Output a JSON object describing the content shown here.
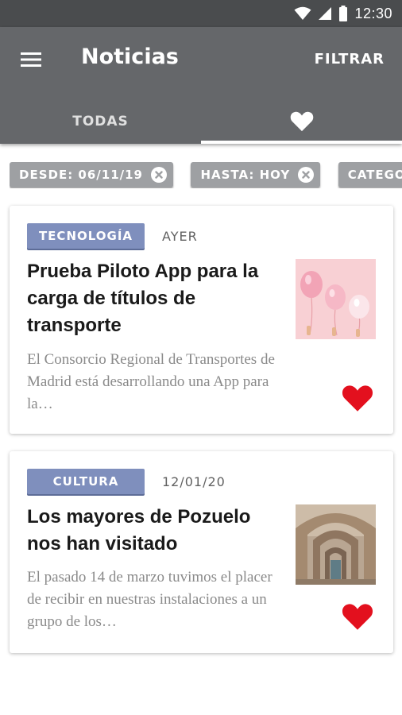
{
  "status": {
    "time": "12:30"
  },
  "app_bar": {
    "title": "Noticias",
    "filter_label": "FILTRAR"
  },
  "tabs": [
    {
      "label": "TODAS",
      "active": false
    },
    {
      "label": "",
      "icon": "heart-icon",
      "active": true
    }
  ],
  "filters": [
    {
      "label": "DESDE: 06/11/19"
    },
    {
      "label": "HASTA: HOY"
    },
    {
      "label": "CATEGO"
    }
  ],
  "news": [
    {
      "category": "TECNOLOGÍA",
      "date": "AYER",
      "title": "Prueba Piloto App para la carga de títulos de transporte",
      "excerpt": "El Consorcio Regional de Transportes de Madrid está desarrollando una App para la…",
      "thumbnail": "balloons-image",
      "favorite": true
    },
    {
      "category": "CULTURA",
      "date": "12/01/20",
      "title": "Los mayores de Pozuelo nos han visitado",
      "excerpt": "El pasado 14 de marzo tuvimos el placer de recibir en nuestras instalaciones a un grupo de los…",
      "thumbnail": "arches-image",
      "favorite": true
    }
  ],
  "colors": {
    "status_bar": "#4a4c4e",
    "app_bar": "#65676a",
    "chip": "#9ea0a3",
    "badge": "#7f8fbd",
    "favorite": "#e3101e"
  }
}
